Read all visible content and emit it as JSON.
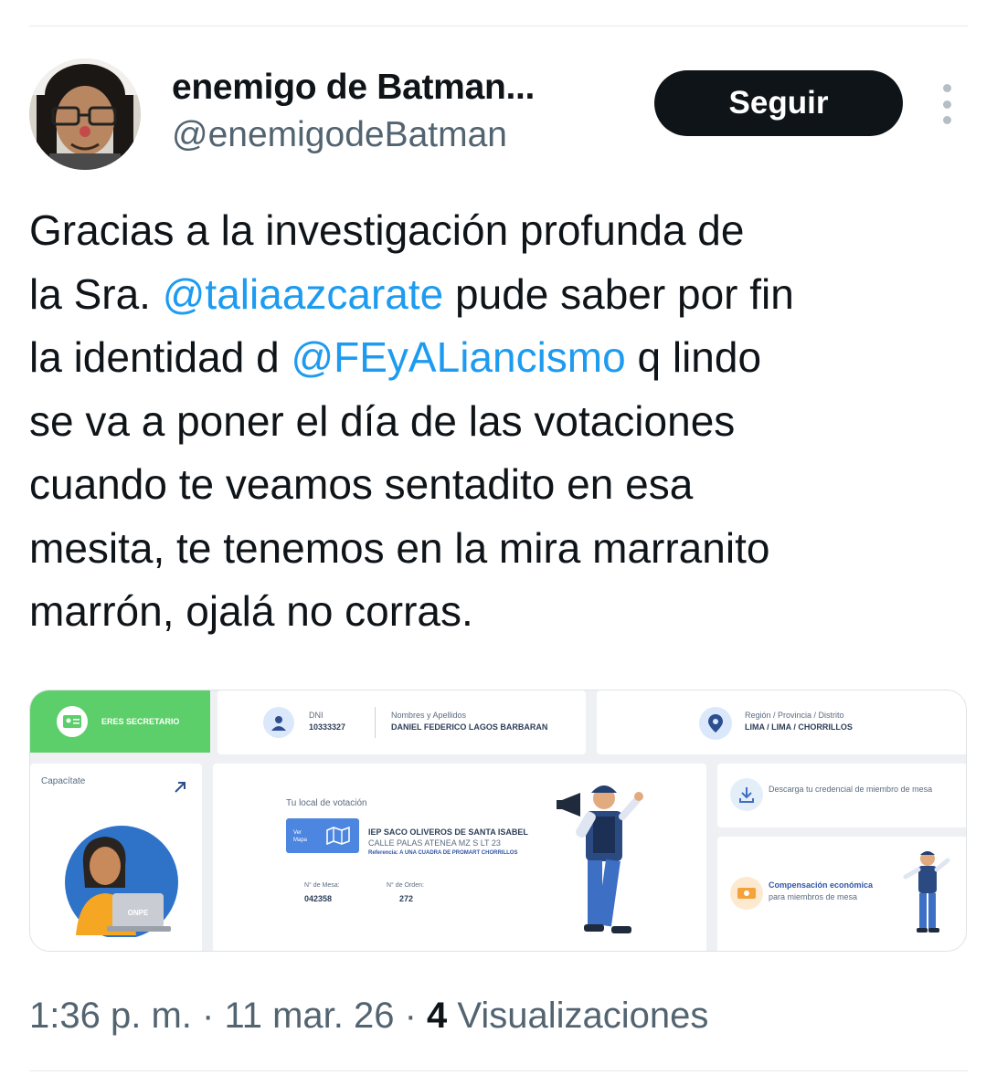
{
  "author": {
    "display_name": "enemigo de Batman...",
    "handle": "@enemigodeBatman",
    "follow_label": "Seguir"
  },
  "tweet": {
    "lines": [
      [
        {
          "t": "Gracias a la investigación profunda de"
        }
      ],
      [
        {
          "t": "la Sra. "
        },
        {
          "t": "@taliaazcarate",
          "mention": true
        },
        {
          "t": " pude saber por fin"
        }
      ],
      [
        {
          "t": "la identidad d "
        },
        {
          "t": "@FEyALiancismo",
          "mention": true
        },
        {
          "t": " q lindo"
        }
      ],
      [
        {
          "t": "se va a poner el día de las votaciones"
        }
      ],
      [
        {
          "t": "cuando te veamos sentadito en esa"
        }
      ],
      [
        {
          "t": "mesita, te tenemos en la mira marranito"
        }
      ],
      [
        {
          "t": "marrón, ojalá no corras."
        }
      ]
    ]
  },
  "card": {
    "role_badge": "ERES SECRETARIO",
    "dni_label": "DNI",
    "dni_value": "10333327",
    "names_label": "Nombres y Apellidos",
    "names_value": "DANIEL FEDERICO LAGOS BARBARAN",
    "region_label": "Región / Provincia / Distrito",
    "region_value": "LIMA / LIMA / CHORRILLOS",
    "capacitate": "Capacítate",
    "onpe": "ONPE",
    "local_title": "Tu local de votación",
    "ver_mapa": "Ver Mapa",
    "school": "IEP SACO OLIVEROS DE SANTA ISABEL",
    "address": "CALLE PALAS ATENEA MZ S LT 23",
    "reference": "Referencia: A UNA CUADRA DE PROMART CHORRILLOS",
    "mesa_label": "N° de Mesa:",
    "mesa_value": "042358",
    "orden_label": "N° de Orden:",
    "orden_value": "272",
    "download": "Descarga tu credencial de miembro de mesa",
    "comp_title": "Compensación económica",
    "comp_sub": "para miembros de mesa"
  },
  "meta": {
    "time": "1:36 p. m.",
    "date": "11 mar. 26",
    "views_count": "4",
    "views_label": "Visualizaciones"
  },
  "colors": {
    "mention": "#1d9bf0",
    "follow_bg": "#0f1419",
    "badge_green": "#5ccf6a"
  }
}
